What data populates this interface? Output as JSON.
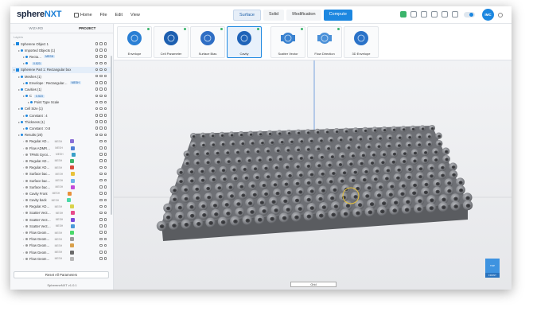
{
  "app": {
    "logo_main": "sphere",
    "logo_accent": "NXT"
  },
  "menu": {
    "home": "Home",
    "file": "File",
    "edit": "Edit",
    "view": "View"
  },
  "modes": {
    "surface": "Surface",
    "solid": "Solid",
    "modification": "Modification",
    "compute": "Compute"
  },
  "user": {
    "initials": "IMC"
  },
  "left_panel": {
    "tab_wizard": "WIZARD",
    "tab_project": "PROJECT",
    "layers_label": "Layers",
    "reset_button": "Reset All Parameters",
    "version": "SphereneNXT v1.0.1"
  },
  "tree": [
    {
      "label": "Spherene Object 1",
      "level": 0,
      "hl": false
    },
    {
      "label": "Imported Objects (1)",
      "level": 1,
      "hl": false
    },
    {
      "label": "Recta…",
      "level": 2,
      "badge": "MESH",
      "hl": false
    },
    {
      "label": "",
      "level": 2,
      "badge": "0.523",
      "hl": false
    },
    {
      "label": "Spherene Part 1: Rectangular box",
      "level": 0,
      "hl": true
    },
    {
      "label": "Meshes (1)",
      "level": 1,
      "hl": false
    },
    {
      "label": "Envelope : Rectangular…",
      "level": 2,
      "badge": "MESH",
      "hl": false
    },
    {
      "label": "Cavities (1)",
      "level": 1,
      "hl": false
    },
    {
      "label": "C",
      "level": 2,
      "badge": "0.523",
      "hl": false
    },
    {
      "label": "Point Type      Scale",
      "level": 3,
      "hl": false
    },
    {
      "label": "Cell Size (1)",
      "level": 1,
      "hl": false
    },
    {
      "label": "Constant : 4",
      "level": 2,
      "hl": false
    },
    {
      "label": "Thickness (1)",
      "level": 1,
      "hl": false
    },
    {
      "label": "Constant : 0.8",
      "level": 2,
      "hl": false
    },
    {
      "label": "Results (20)",
      "level": 1,
      "hl": false
    }
  ],
  "results": [
    {
      "label": "Regular AD…",
      "color": "#8a6fd6"
    },
    {
      "label": "Flow ADMR…",
      "color": "#4f7fd6"
    },
    {
      "label": "TPMS Gyroi…",
      "color": "#3aa0c8"
    },
    {
      "label": "Regular AD…",
      "color": "#3bb46b"
    },
    {
      "label": "Regular AD…",
      "color": "#d94a3a"
    },
    {
      "label": "Surface bac…",
      "color": "#e8c23a"
    },
    {
      "label": "Surface bac…",
      "color": "#6db4e8"
    },
    {
      "label": "Surface bac…",
      "color": "#c24ad9"
    },
    {
      "label": "Cavity Front",
      "color": "#e8903a"
    },
    {
      "label": "Cavity back",
      "color": "#4ad9a8"
    },
    {
      "label": "Regular AD…",
      "color": "#d9d24a"
    },
    {
      "label": "Scatter Vect…",
      "color": "#e84a8a"
    },
    {
      "label": "Scatter Vect…",
      "color": "#7a4ad9"
    },
    {
      "label": "Scatter Vect…",
      "color": "#4a9ad9"
    },
    {
      "label": "Flow Geom…",
      "color": "#4ad96a"
    },
    {
      "label": "Flow Geom…",
      "color": "#9a9a9a"
    },
    {
      "label": "Flow Geom…",
      "color": "#d9a04a"
    },
    {
      "label": "Flow Geom…",
      "color": "#6a6a6a"
    },
    {
      "label": "Flow Geom…",
      "color": "#b8b8b8"
    }
  ],
  "results_mesh": "MESH",
  "features": [
    {
      "label": "Envelope",
      "icon": "sphere-wire-icon"
    },
    {
      "label": "Cell Parameter",
      "icon": "cell-parameter-icon"
    },
    {
      "label": "Surface Bias",
      "icon": "surface-bias-icon"
    },
    {
      "label": "Cavity",
      "icon": "cavity-icon"
    },
    {
      "label": "Scatter Vector",
      "icon": "scatter-vector-icon"
    },
    {
      "label": "Flow Direction",
      "icon": "flow-direction-icon"
    },
    {
      "label": "3D Envelope",
      "icon": "3d-envelope-icon"
    }
  ],
  "viewport": {
    "scale_label": "Grid",
    "cube_top": "TOP",
    "cube_front": "FRONT"
  }
}
